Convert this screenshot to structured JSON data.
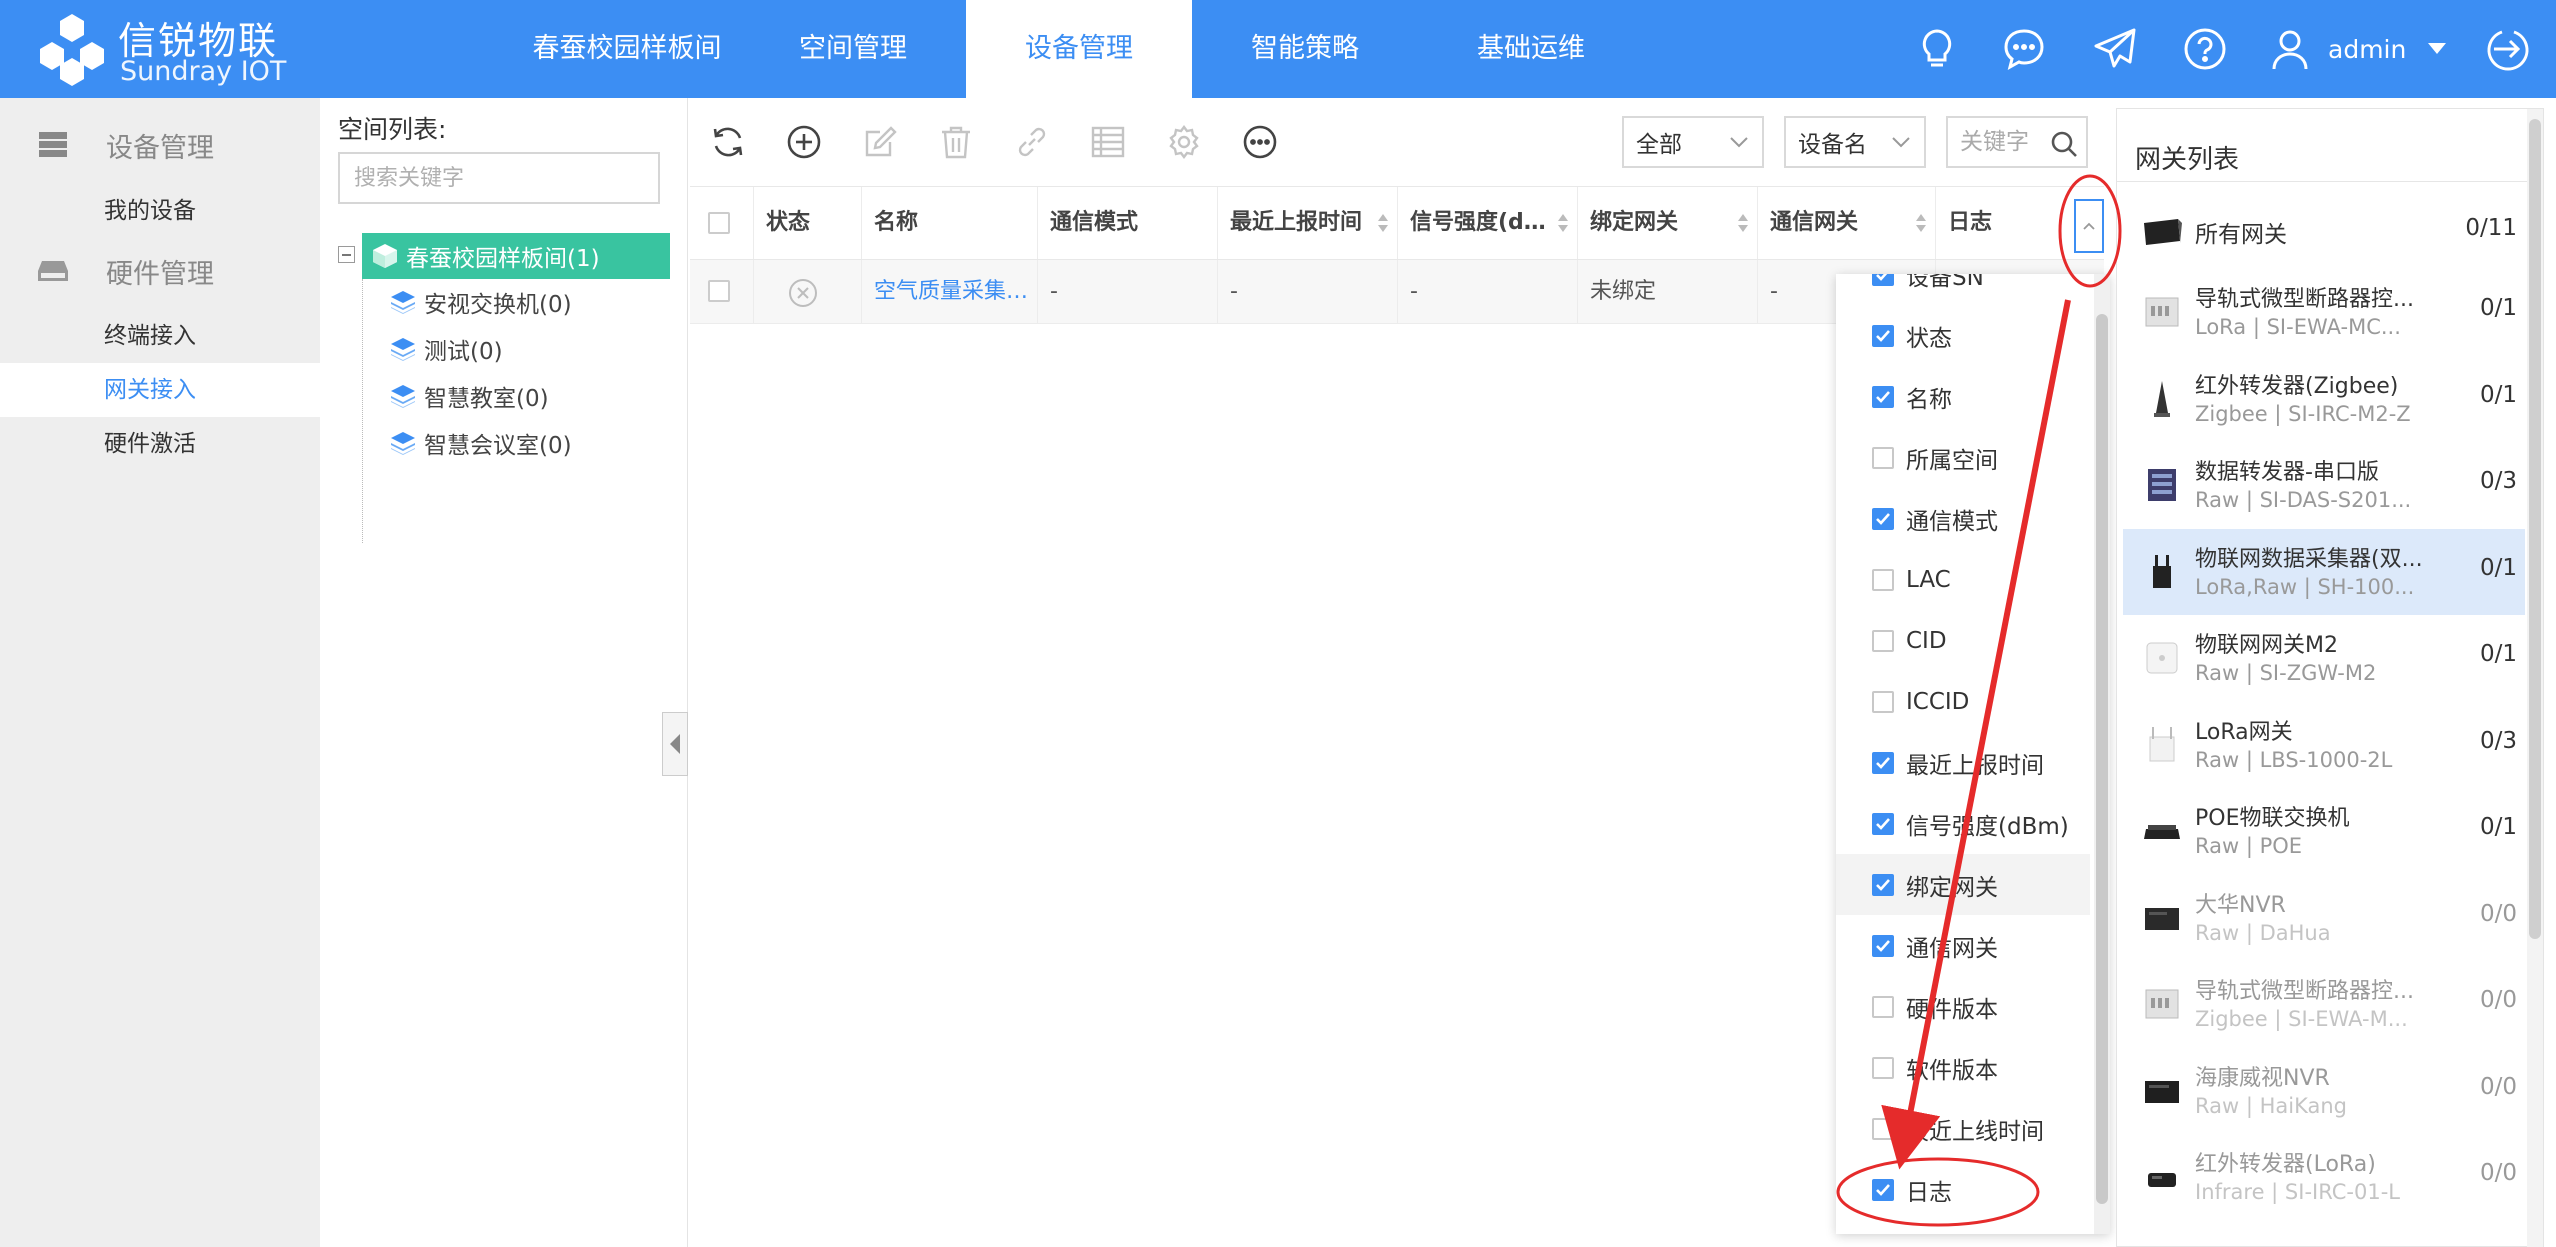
{
  "brand": {
    "name_cn": "信锐物联",
    "name_en": "Sundray IOT"
  },
  "nav": {
    "tabs": [
      {
        "label": "春蚕校园样板间"
      },
      {
        "label": "空间管理"
      },
      {
        "label": "设备管理"
      },
      {
        "label": "智能策略"
      },
      {
        "label": "基础运维"
      }
    ],
    "active_tab": "设备管理",
    "user": "admin",
    "icons": [
      "bulb-icon",
      "chat-icon",
      "send-icon",
      "help-icon",
      "user-icon",
      "logout-icon"
    ]
  },
  "sidebar": {
    "groups": [
      {
        "label": "设备管理",
        "icon": "server-icon",
        "items": [
          {
            "label": "我的设备"
          }
        ]
      },
      {
        "label": "硬件管理",
        "icon": "drive-icon",
        "items": [
          {
            "label": "终端接入"
          },
          {
            "label": "网关接入"
          },
          {
            "label": "硬件激活"
          }
        ]
      }
    ],
    "active_item": "网关接入"
  },
  "tree": {
    "title": "空间列表:",
    "search_placeholder": "搜索关键字",
    "root": "春蚕校园样板间(1)",
    "children": [
      "安视交换机(0)",
      "测试(0)",
      "智慧教室(0)",
      "智慧会议室(0)"
    ]
  },
  "toolbar": {
    "filter_scope": "全部",
    "filter_field": "设备名",
    "keyword_placeholder": "关键字"
  },
  "table": {
    "columns": [
      "状态",
      "名称",
      "通信模式",
      "最近上报时间",
      "信号强度(d…",
      "绑定网关",
      "通信网关",
      "日志"
    ],
    "rows": [
      {
        "status_icon": "offline-icon",
        "name": "空气质量采集…",
        "mode": "-",
        "last_report": "-",
        "signal": "-",
        "bound_gateway": "未绑定",
        "comm_gateway": "-"
      }
    ]
  },
  "column_picker": {
    "options": [
      {
        "label": "设备SN",
        "checked": true
      },
      {
        "label": "状态",
        "checked": true
      },
      {
        "label": "名称",
        "checked": true
      },
      {
        "label": "所属空间",
        "checked": false
      },
      {
        "label": "通信模式",
        "checked": true
      },
      {
        "label": "LAC",
        "checked": false
      },
      {
        "label": "CID",
        "checked": false
      },
      {
        "label": "ICCID",
        "checked": false
      },
      {
        "label": "最近上报时间",
        "checked": true
      },
      {
        "label": "信号强度(dBm)",
        "checked": true
      },
      {
        "label": "绑定网关",
        "checked": true
      },
      {
        "label": "通信网关",
        "checked": true
      },
      {
        "label": "硬件版本",
        "checked": false
      },
      {
        "label": "软件版本",
        "checked": false
      },
      {
        "label": "最近上线时间",
        "checked": false
      },
      {
        "label": "日志",
        "checked": true
      }
    ]
  },
  "gateways": {
    "title": "网关列表",
    "all": {
      "name": "所有网关",
      "count": "0/11"
    },
    "items": [
      {
        "name": "导轨式微型断路器控...",
        "sub": "LoRa | SI-EWA-MC...",
        "count": "0/1"
      },
      {
        "name": "红外转发器(Zigbee)",
        "sub": "Zigbee | SI-IRC-M2-Z",
        "count": "0/1"
      },
      {
        "name": "数据转发器-串口版",
        "sub": "Raw | SI-DAS-S201...",
        "count": "0/3"
      },
      {
        "name": "物联网数据采集器(双...",
        "sub": "LoRa,Raw | SH-100...",
        "count": "0/1"
      },
      {
        "name": "物联网网关M2",
        "sub": "Raw | SI-ZGW-M2",
        "count": "0/1"
      },
      {
        "name": "LoRa网关",
        "sub": "Raw | LBS-1000-2L",
        "count": "0/3"
      },
      {
        "name": "POE物联交换机",
        "sub": "Raw | POE",
        "count": "0/1"
      },
      {
        "name": "大华NVR",
        "sub": "Raw | DaHua",
        "count": "0/0"
      },
      {
        "name": "导轨式微型断路器控...",
        "sub": "Zigbee | SI-EWA-M...",
        "count": "0/0"
      },
      {
        "name": "海康威视NVR",
        "sub": "Raw | HaiKang",
        "count": "0/0"
      },
      {
        "name": "红外转发器(LoRa)",
        "sub": "Infrare | SI-IRC-01-L",
        "count": "0/0"
      }
    ],
    "selected": "物联网数据采集器(双..."
  },
  "colors": {
    "primary": "#3c8ef3",
    "tree_active": "#39c4a0",
    "annotation": "#e52b2b"
  }
}
